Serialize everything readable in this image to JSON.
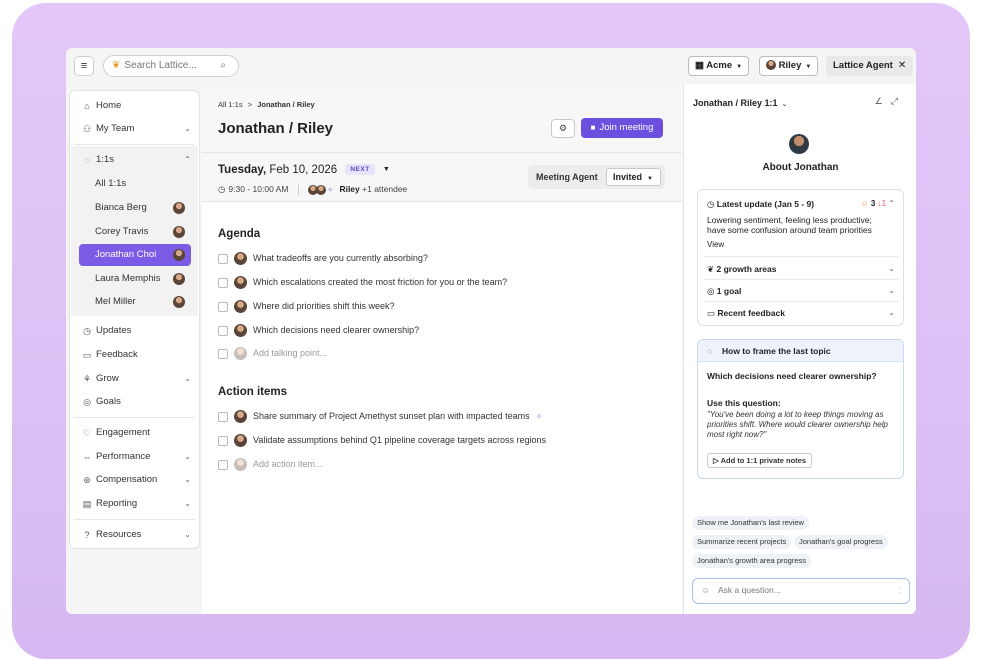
{
  "topbar": {
    "search_placeholder": "Search Lattice...",
    "org": "Acme",
    "user": "Riley",
    "agent_label": "Lattice Agent"
  },
  "sidebar": {
    "home": "Home",
    "my_team": "My Team",
    "one_on_ones": "1:1s",
    "sub_items": [
      "All 1:1s",
      "Bianca Berg",
      "Corey Travis",
      "Jonathan Choi",
      "Laura Memphis",
      "Mel Miller"
    ],
    "active_sub": "Jonathan Choi",
    "updates": "Updates",
    "feedback": "Feedback",
    "grow": "Grow",
    "goals": "Goals",
    "engagement": "Engagement",
    "performance": "Performance",
    "compensation": "Compensation",
    "reporting": "Reporting",
    "resources": "Resources"
  },
  "main": {
    "breadcrumb_parent": "All 1:1s",
    "breadcrumb_sep": ">",
    "breadcrumb_current": "Jonathan / Riley",
    "title": "Jonathan / Riley",
    "join_label": "Join meeting",
    "date_day": "Tuesday,",
    "date_rest": " Feb 10, 2026",
    "next_badge": "NEXT",
    "time": "9:30 - 10:00 AM",
    "host": "Riley",
    "attendees": "+1 attendee",
    "meeting_agent_label": "Meeting Agent",
    "invited_label": "Invited",
    "agenda_title": "Agenda",
    "agenda_items": [
      "What tradeoffs are you currently absorbing?",
      "Which escalations created the most friction for you or the team?",
      "Where did priorities shift this week?",
      "Which decisions need clearer ownership?"
    ],
    "add_talking_point": "Add talking point...",
    "actions_title": "Action items",
    "action_items": [
      "Share summary of Project Amethyst sunset plan with impacted teams",
      "Validate assumptions behind Q1 pipeline coverage targets across regions"
    ],
    "add_action_item": "Add action item..."
  },
  "panel": {
    "header": "Jonathan / Riley 1:1",
    "about_title": "About Jonathan",
    "latest_update_label": "Latest update (Jan 5 - 9)",
    "sentiment_score": "3",
    "sentiment_delta": "↓1",
    "latest_update_text": "Lowering sentiment, feeling less productive; have some confusion around team priorities",
    "view_link": "View",
    "growth_areas": "2 growth areas",
    "goals": "1 goal",
    "recent_feedback": "Recent feedback",
    "frame_title": "How to frame the last topic",
    "frame_question": "Which decisions need clearer ownership?",
    "use_question_label": "Use this question:",
    "suggested_question": "\"You've been doing a lot to keep things moving as priorities shift. Where would clearer ownership help most right now?\"",
    "add_notes_button": "Add to 1:1 private notes",
    "suggestions": [
      "Show me Jonathan's last review",
      "Summarize recent projects",
      "Jonathan's goal progress",
      "Jonathan's growth area progress"
    ],
    "ask_placeholder": "Ask a question..."
  },
  "colors": {
    "accent": "#6d4fe0",
    "frame_bg": "#dcc0f5"
  }
}
